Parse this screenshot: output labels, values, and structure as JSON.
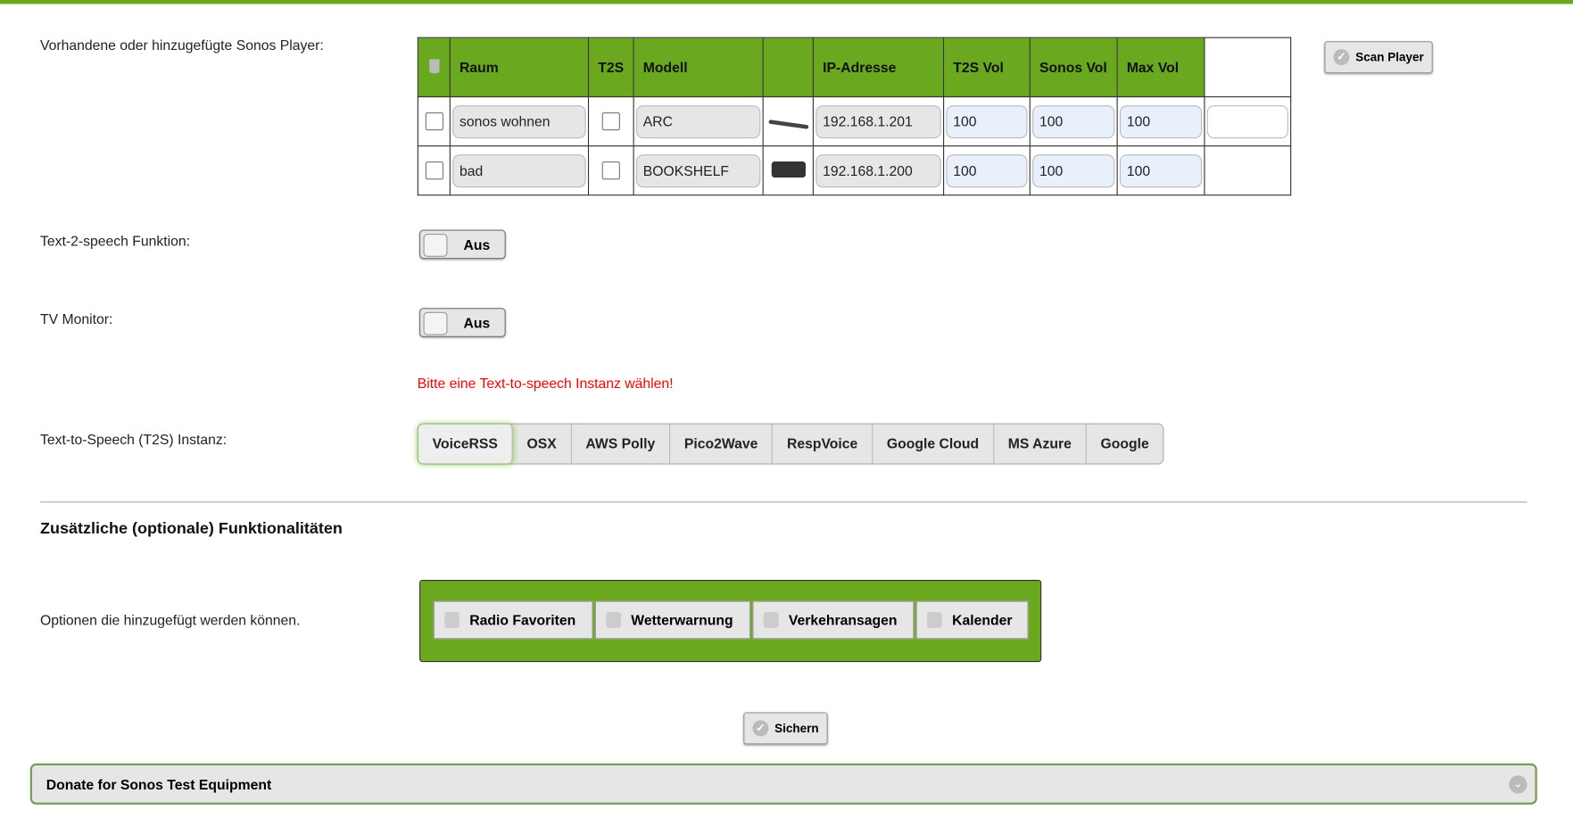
{
  "labels": {
    "players": "Vorhandene oder hinzugefügte Sonos Player:",
    "t2s_func": "Text-2-speech Funktion:",
    "tv": "TV Monitor:",
    "warning": "Bitte eine Text-to-speech Instanz wählen!",
    "instance": "Text-to-Speech (T2S) Instanz:",
    "section": "Zusätzliche (optionale) Funktionalitäten",
    "options": "Optionen die hinzugefügt werden können."
  },
  "table": {
    "headers": [
      "Raum",
      "T2S",
      "Modell",
      "",
      "IP-Adresse",
      "T2S Vol",
      "Sonos Vol",
      "Max Vol"
    ],
    "rows": [
      {
        "raum": "sonos wohnen",
        "modell": "ARC",
        "ip": "192.168.1.201",
        "t2s_vol": "100",
        "sonos_vol": "100",
        "max_vol": "100"
      },
      {
        "raum": "bad",
        "modell": "BOOKSHELF",
        "ip": "192.168.1.200",
        "t2s_vol": "100",
        "sonos_vol": "100",
        "max_vol": "100"
      }
    ]
  },
  "scan_button": "Scan Player",
  "toggles": {
    "t2s": "Aus",
    "tv": "Aus"
  },
  "instances": [
    "VoiceRSS",
    "OSX",
    "AWS Polly",
    "Pico2Wave",
    "RespVoice",
    "Google Cloud",
    "MS Azure",
    "Google"
  ],
  "option_items": [
    "Radio Favoriten",
    "Wetterwarnung",
    "Verkehransagen",
    "Kalender"
  ],
  "save_button": "Sichern",
  "donate": "Donate for Sonos Test Equipment",
  "colors": {
    "accent": "#6aa91f",
    "warning": "#ff0000"
  }
}
